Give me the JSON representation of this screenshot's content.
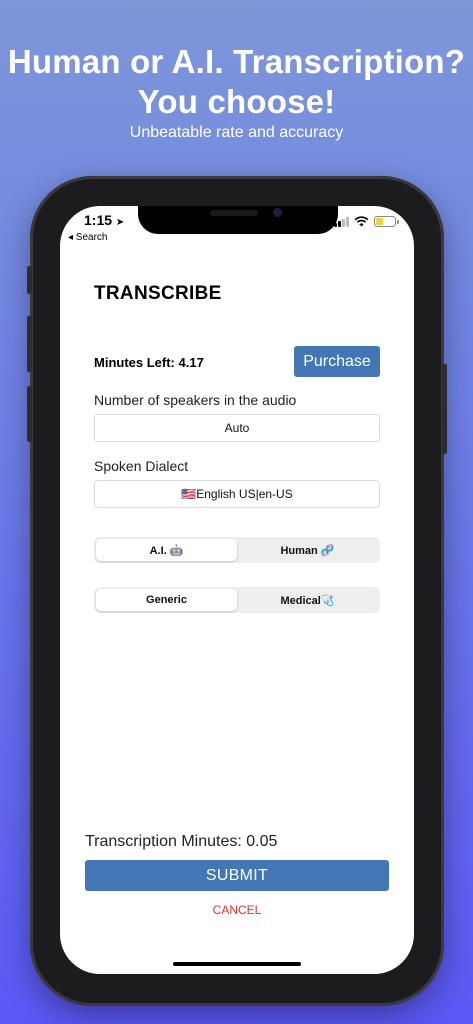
{
  "promo": {
    "title_line1": "Human or A.I. Transcription?",
    "title_line2": "You choose!",
    "subtitle": "Unbeatable rate and accuracy"
  },
  "status_bar": {
    "time": "1:15",
    "back_label": "◂ Search",
    "icons": [
      "location-arrow-icon",
      "signal-icon",
      "wifi-icon",
      "battery-icon"
    ],
    "battery_level": 0.3
  },
  "screen": {
    "title": "TRANSCRIBE",
    "minutes_left": "Minutes Left: 4.17",
    "purchase_label": "Purchase",
    "speakers_label": "Number of speakers in the audio",
    "speakers_value": "Auto",
    "dialect_label": "Spoken Dialect",
    "dialect_value": "🇺🇸English US|en-US",
    "engine_options": [
      "A.I. 🤖",
      "Human 🧬"
    ],
    "engine_selected": "A.I. 🤖",
    "domain_options": [
      "Generic",
      "Medical🩺"
    ],
    "domain_selected": "Generic",
    "transcription_minutes": "Transcription Minutes: 0.05",
    "submit_label": "SUBMIT",
    "cancel_label": "CANCEL"
  },
  "colors": {
    "bg_top": "#7d97d9",
    "bg_bottom": "#5a58f5",
    "button": "#4276b4",
    "cancel": "#e5312b",
    "battery": "#f4d03f"
  }
}
